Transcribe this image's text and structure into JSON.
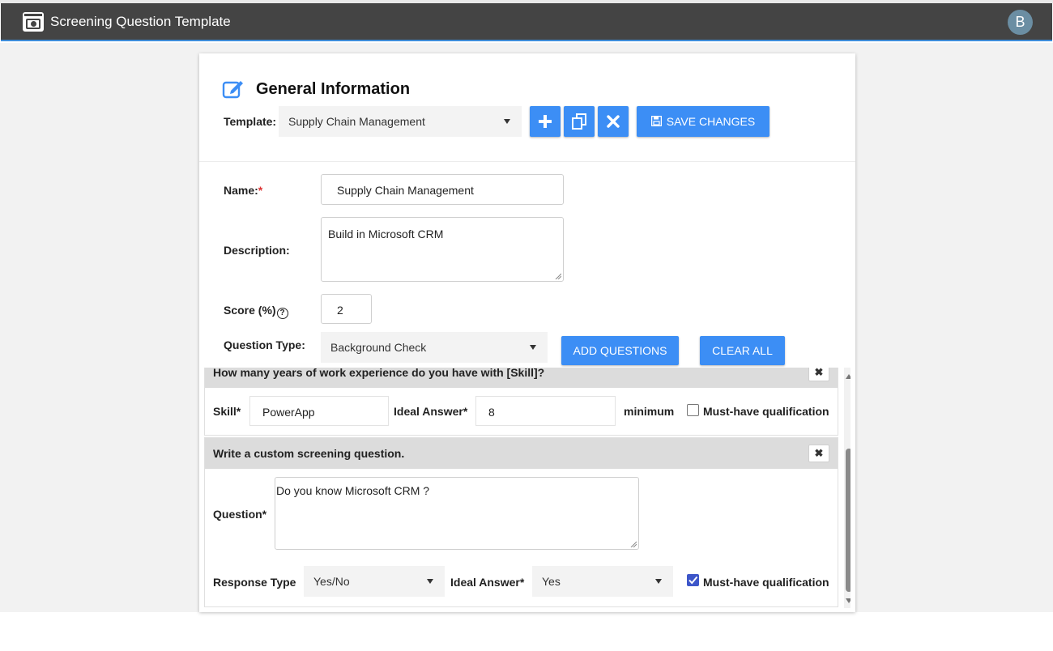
{
  "app": {
    "title": "Screening Question Template",
    "avatar_initial": "B",
    "icon": "app-window-icon"
  },
  "general": {
    "section_title": "General Information",
    "template_label": "Template:",
    "template_value": "Supply Chain Management",
    "save_label": "SAVE CHANGES",
    "icons": {
      "add": "plus-icon",
      "copy": "copy-icon",
      "delete": "close-icon",
      "save": "floppy-disk-icon",
      "edit": "edit-icon"
    }
  },
  "form": {
    "name_label": "Name:",
    "required_mark": "*",
    "name_value": "Supply Chain Management",
    "description_label": "Description:",
    "description_value": "Build in Microsoft CRM",
    "score_label": "Score (%)",
    "score_help": "?",
    "score_value": "2",
    "question_type_label": "Question Type:",
    "question_type_value": "Background Check",
    "add_questions_label": "ADD QUESTIONS",
    "clear_all_label": "CLEAR ALL"
  },
  "questions": [
    {
      "title": "How many years of work experience do you have with [Skill]?",
      "skill_label": "Skill*",
      "skill_value": "PowerApp",
      "ideal_label": "Ideal Answer*",
      "ideal_value": "8",
      "unit_label": "minimum",
      "must_have_label": "Must-have qualification",
      "must_have_checked": false,
      "close_glyph": "✖"
    },
    {
      "title": "Write a custom screening question.",
      "question_label": "Question*",
      "question_value": "Do you know Microsoft CRM ?",
      "response_type_label": "Response Type",
      "response_type_value": "Yes/No",
      "ideal_label": "Ideal Answer*",
      "ideal_value": "Yes",
      "must_have_label": "Must-have qualification",
      "must_have_checked": true,
      "close_glyph": "✖"
    }
  ],
  "colors": {
    "titlebar": "#444444",
    "accent": "#3c8ef5",
    "checkbox_checked": "#3d56c9"
  }
}
